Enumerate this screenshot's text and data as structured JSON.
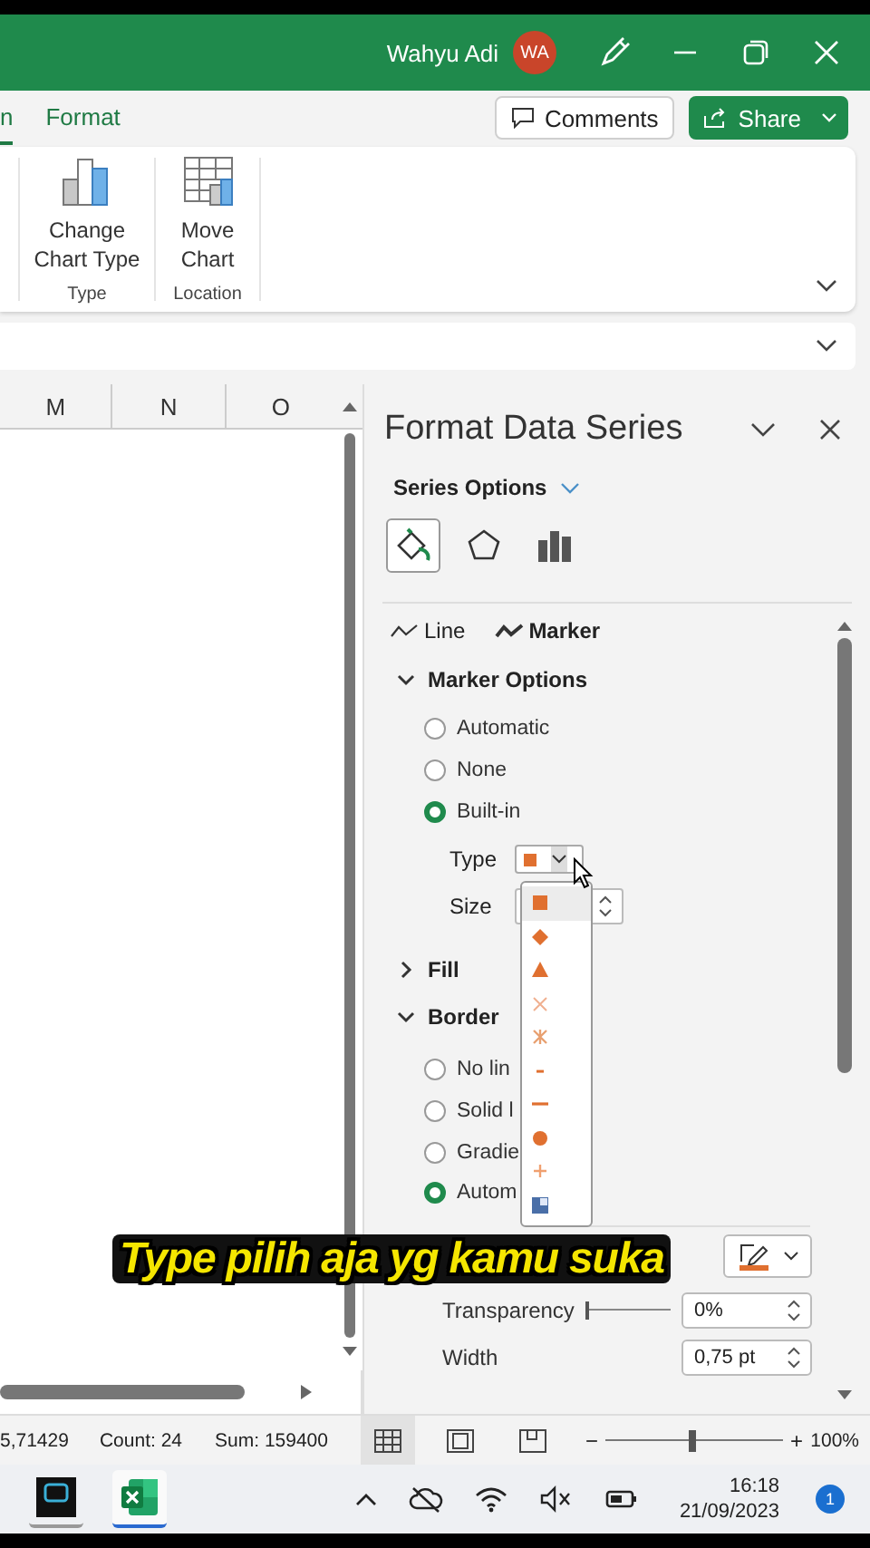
{
  "title_bar": {
    "user": "Wahyu Adi",
    "avatar": "WA"
  },
  "ribbon_tabs": [
    {
      "label": "n",
      "selected": true
    },
    {
      "label": "Format",
      "selected": false
    }
  ],
  "comments_button": "Comments",
  "share_button": "Share",
  "ribbon_groups": [
    {
      "button": "Change Chart Type",
      "kind": "chart-type",
      "label": "Type"
    },
    {
      "button": "Move Chart",
      "kind": "move-chart",
      "label": "Location"
    }
  ],
  "columns": [
    "M",
    "N",
    "O"
  ],
  "pane": {
    "title": "Format Data Series",
    "options_label": "Series Options",
    "icon_tabs": [
      {
        "kind": "fill",
        "selected": true
      },
      {
        "kind": "effects",
        "selected": false
      },
      {
        "kind": "series",
        "selected": false
      }
    ],
    "subtabs": [
      {
        "label": "Line",
        "selected": false
      },
      {
        "label": "Marker",
        "selected": true
      }
    ],
    "marker_options": {
      "title": "Marker Options",
      "expanded": true,
      "radios": [
        {
          "label": "Automatic",
          "selected": false
        },
        {
          "label": "None",
          "selected": false
        },
        {
          "label": "Built-in",
          "selected": true
        }
      ],
      "type_label": "Type",
      "size_label": "Size"
    },
    "fill": {
      "title": "Fill",
      "expanded": false
    },
    "border": {
      "title": "Border",
      "expanded": true,
      "radios": [
        {
          "label": "No lin",
          "selected": false
        },
        {
          "label": "Solid l",
          "selected": false
        },
        {
          "label": "Gradie",
          "selected": false
        },
        {
          "label": "Autom",
          "selected": true
        }
      ],
      "transparency_label": "Transparency",
      "transparency": {
        "level": 0
      },
      "transparency_value": "0%",
      "width_label": "Width",
      "width_value": "0,75 pt"
    },
    "marker_types": [
      {
        "kind": "square",
        "selected": true
      },
      {
        "kind": "diamond",
        "selected": false
      },
      {
        "kind": "triangle",
        "selected": false
      },
      {
        "kind": "x",
        "selected": false
      },
      {
        "kind": "star",
        "selected": false
      },
      {
        "kind": "short-dash",
        "selected": false
      },
      {
        "kind": "long-dash",
        "selected": false
      },
      {
        "kind": "circle",
        "selected": false
      },
      {
        "kind": "plus",
        "selected": false
      },
      {
        "kind": "picture",
        "selected": false
      }
    ]
  },
  "caption": "Type pilih aja yg kamu suka",
  "status_bar": {
    "items": [
      "5,71429",
      "Count: 24",
      "Sum: 159400"
    ],
    "views": [
      {
        "kind": "normal",
        "selected": true
      },
      {
        "kind": "page-layout",
        "selected": false
      },
      {
        "kind": "page-break",
        "selected": false
      }
    ],
    "zoom_out": "−",
    "zoom": {
      "level": 0.5
    },
    "zoom_in": "+",
    "zoom_label": "100%"
  },
  "taskbar": {
    "apps": [
      {
        "kind": "recorder",
        "selected": false
      },
      {
        "kind": "excel",
        "selected": true
      }
    ],
    "time": "16:18",
    "date": "21/09/2023",
    "notifications": "1"
  }
}
